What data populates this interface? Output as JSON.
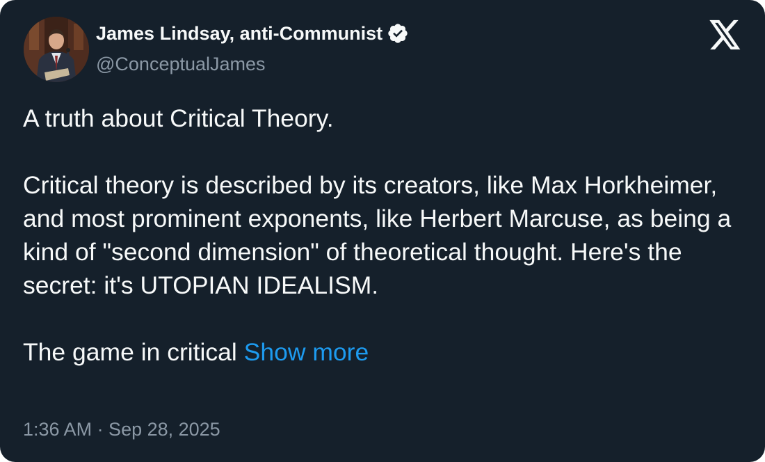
{
  "author": {
    "name": "James Lindsay, anti-Communist",
    "handle": "@ConceptualJames",
    "verified": true
  },
  "tweet": {
    "paragraphs": [
      "A truth about Critical Theory.",
      "Critical theory is described by its creators, like Max Horkheimer, and most prominent exponents, like Herbert Marcuse, as being a kind of \"second dimension\" of theoretical thought. Here's the secret: it's UTOPIAN IDEALISM.",
      "The game in critical "
    ],
    "show_more_label": "Show more",
    "timestamp": "1:36 AM · Sep 28, 2025"
  },
  "icons": {
    "platform_logo": "x-logo-icon",
    "verified": "verified-badge-icon"
  },
  "colors": {
    "background": "#15202b",
    "text": "#f7f9f9",
    "secondary_text": "#8b98a5",
    "link": "#1d9bf0"
  }
}
